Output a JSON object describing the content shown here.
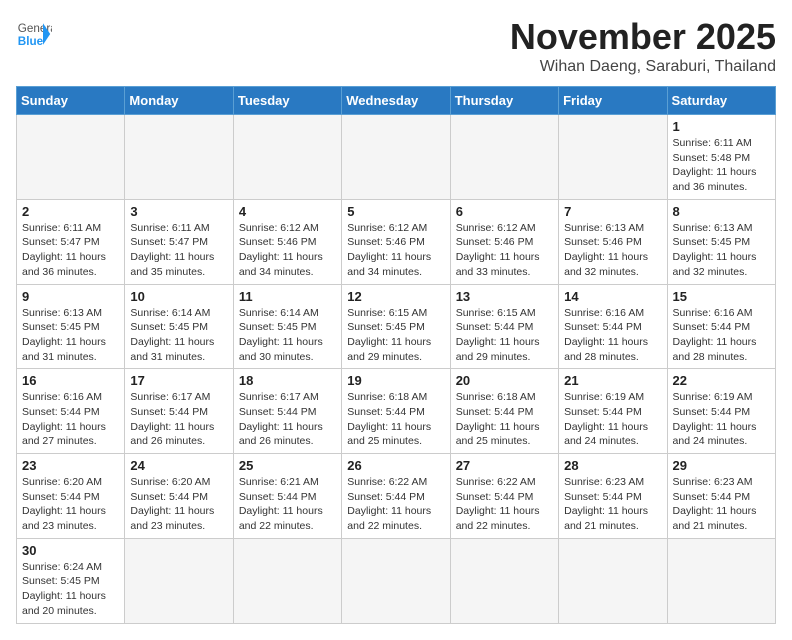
{
  "header": {
    "logo_general": "General",
    "logo_blue": "Blue",
    "month_title": "November 2025",
    "location": "Wihan Daeng, Saraburi, Thailand"
  },
  "weekdays": [
    "Sunday",
    "Monday",
    "Tuesday",
    "Wednesday",
    "Thursday",
    "Friday",
    "Saturday"
  ],
  "weeks": [
    [
      {
        "day": "",
        "info": ""
      },
      {
        "day": "",
        "info": ""
      },
      {
        "day": "",
        "info": ""
      },
      {
        "day": "",
        "info": ""
      },
      {
        "day": "",
        "info": ""
      },
      {
        "day": "",
        "info": ""
      },
      {
        "day": "1",
        "info": "Sunrise: 6:11 AM\nSunset: 5:48 PM\nDaylight: 11 hours\nand 36 minutes."
      }
    ],
    [
      {
        "day": "2",
        "info": "Sunrise: 6:11 AM\nSunset: 5:47 PM\nDaylight: 11 hours\nand 36 minutes."
      },
      {
        "day": "3",
        "info": "Sunrise: 6:11 AM\nSunset: 5:47 PM\nDaylight: 11 hours\nand 35 minutes."
      },
      {
        "day": "4",
        "info": "Sunrise: 6:12 AM\nSunset: 5:46 PM\nDaylight: 11 hours\nand 34 minutes."
      },
      {
        "day": "5",
        "info": "Sunrise: 6:12 AM\nSunset: 5:46 PM\nDaylight: 11 hours\nand 34 minutes."
      },
      {
        "day": "6",
        "info": "Sunrise: 6:12 AM\nSunset: 5:46 PM\nDaylight: 11 hours\nand 33 minutes."
      },
      {
        "day": "7",
        "info": "Sunrise: 6:13 AM\nSunset: 5:46 PM\nDaylight: 11 hours\nand 32 minutes."
      },
      {
        "day": "8",
        "info": "Sunrise: 6:13 AM\nSunset: 5:45 PM\nDaylight: 11 hours\nand 32 minutes."
      }
    ],
    [
      {
        "day": "9",
        "info": "Sunrise: 6:13 AM\nSunset: 5:45 PM\nDaylight: 11 hours\nand 31 minutes."
      },
      {
        "day": "10",
        "info": "Sunrise: 6:14 AM\nSunset: 5:45 PM\nDaylight: 11 hours\nand 31 minutes."
      },
      {
        "day": "11",
        "info": "Sunrise: 6:14 AM\nSunset: 5:45 PM\nDaylight: 11 hours\nand 30 minutes."
      },
      {
        "day": "12",
        "info": "Sunrise: 6:15 AM\nSunset: 5:45 PM\nDaylight: 11 hours\nand 29 minutes."
      },
      {
        "day": "13",
        "info": "Sunrise: 6:15 AM\nSunset: 5:44 PM\nDaylight: 11 hours\nand 29 minutes."
      },
      {
        "day": "14",
        "info": "Sunrise: 6:16 AM\nSunset: 5:44 PM\nDaylight: 11 hours\nand 28 minutes."
      },
      {
        "day": "15",
        "info": "Sunrise: 6:16 AM\nSunset: 5:44 PM\nDaylight: 11 hours\nand 28 minutes."
      }
    ],
    [
      {
        "day": "16",
        "info": "Sunrise: 6:16 AM\nSunset: 5:44 PM\nDaylight: 11 hours\nand 27 minutes."
      },
      {
        "day": "17",
        "info": "Sunrise: 6:17 AM\nSunset: 5:44 PM\nDaylight: 11 hours\nand 26 minutes."
      },
      {
        "day": "18",
        "info": "Sunrise: 6:17 AM\nSunset: 5:44 PM\nDaylight: 11 hours\nand 26 minutes."
      },
      {
        "day": "19",
        "info": "Sunrise: 6:18 AM\nSunset: 5:44 PM\nDaylight: 11 hours\nand 25 minutes."
      },
      {
        "day": "20",
        "info": "Sunrise: 6:18 AM\nSunset: 5:44 PM\nDaylight: 11 hours\nand 25 minutes."
      },
      {
        "day": "21",
        "info": "Sunrise: 6:19 AM\nSunset: 5:44 PM\nDaylight: 11 hours\nand 24 minutes."
      },
      {
        "day": "22",
        "info": "Sunrise: 6:19 AM\nSunset: 5:44 PM\nDaylight: 11 hours\nand 24 minutes."
      }
    ],
    [
      {
        "day": "23",
        "info": "Sunrise: 6:20 AM\nSunset: 5:44 PM\nDaylight: 11 hours\nand 23 minutes."
      },
      {
        "day": "24",
        "info": "Sunrise: 6:20 AM\nSunset: 5:44 PM\nDaylight: 11 hours\nand 23 minutes."
      },
      {
        "day": "25",
        "info": "Sunrise: 6:21 AM\nSunset: 5:44 PM\nDaylight: 11 hours\nand 22 minutes."
      },
      {
        "day": "26",
        "info": "Sunrise: 6:22 AM\nSunset: 5:44 PM\nDaylight: 11 hours\nand 22 minutes."
      },
      {
        "day": "27",
        "info": "Sunrise: 6:22 AM\nSunset: 5:44 PM\nDaylight: 11 hours\nand 22 minutes."
      },
      {
        "day": "28",
        "info": "Sunrise: 6:23 AM\nSunset: 5:44 PM\nDaylight: 11 hours\nand 21 minutes."
      },
      {
        "day": "29",
        "info": "Sunrise: 6:23 AM\nSunset: 5:44 PM\nDaylight: 11 hours\nand 21 minutes."
      }
    ],
    [
      {
        "day": "30",
        "info": "Sunrise: 6:24 AM\nSunset: 5:45 PM\nDaylight: 11 hours\nand 20 minutes."
      },
      {
        "day": "",
        "info": ""
      },
      {
        "day": "",
        "info": ""
      },
      {
        "day": "",
        "info": ""
      },
      {
        "day": "",
        "info": ""
      },
      {
        "day": "",
        "info": ""
      },
      {
        "day": "",
        "info": ""
      }
    ]
  ]
}
